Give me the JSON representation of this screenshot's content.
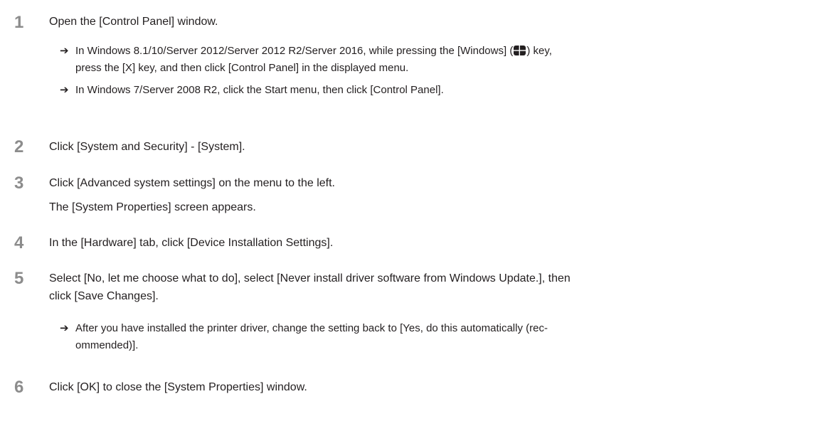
{
  "steps": [
    {
      "number": "1",
      "text": "Open the [Control Panel] window.",
      "subs": [
        {
          "arrow": "➔",
          "before_icon": "In Windows 8.1/10/Server 2012/Server 2012 R2/Server 2016, while pressing the [Windows] (",
          "icon": "windows-logo-icon",
          "after_icon_line1": ") key,",
          "line2": "press the [X] key, and then click [Control Panel] in the displayed menu."
        },
        {
          "arrow": "➔",
          "text": "In Windows 7/Server 2008 R2, click the Start menu, then click [Control Panel]."
        }
      ]
    },
    {
      "number": "2",
      "text": "Click [System and Security] - [System]."
    },
    {
      "number": "3",
      "text": "Click [Advanced system settings] on the menu to the left.",
      "result": "The [System Properties] screen appears."
    },
    {
      "number": "4",
      "text": "In the [Hardware] tab, click [Device Installation Settings]."
    },
    {
      "number": "5",
      "text_line1": "Select [No, let me choose what to do], select [Never install driver software from Windows Update.], then",
      "text_line2": "click [Save Changes].",
      "subs": [
        {
          "arrow": "➔",
          "line1": "After you have installed the printer driver, change the setting back to [Yes, do this automatically (rec-",
          "line2": "ommended)]."
        }
      ]
    },
    {
      "number": "6",
      "text": "Click [OK] to close the [System Properties] window."
    }
  ]
}
